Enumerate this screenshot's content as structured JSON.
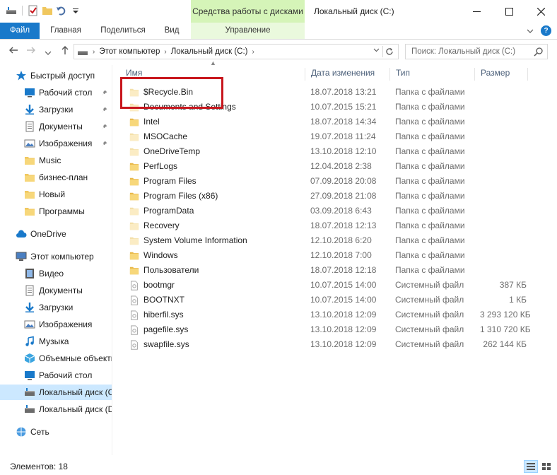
{
  "window": {
    "title": "Локальный диск (C:)",
    "context_tab_title": "Средства работы с дисками"
  },
  "ribbon": {
    "tabs": [
      "Файл",
      "Главная",
      "Поделиться",
      "Вид",
      "Управление"
    ]
  },
  "address": {
    "crumbs": [
      "Этот компьютер",
      "Локальный диск (C:)"
    ],
    "search_placeholder": "Поиск: Локальный диск (C:)"
  },
  "nav": {
    "items": [
      {
        "label": "Быстрый доступ",
        "icon": "star-icon"
      },
      {
        "label": "Рабочий стол",
        "icon": "desktop-icon"
      },
      {
        "label": "Загрузки",
        "icon": "downloads-icon"
      },
      {
        "label": "Документы",
        "icon": "documents-icon"
      },
      {
        "label": "Изображения",
        "icon": "pictures-icon"
      },
      {
        "label": "Music",
        "icon": "folder-icon"
      },
      {
        "label": "бизнес-план",
        "icon": "folder-icon"
      },
      {
        "label": "Новый",
        "icon": "folder-icon"
      },
      {
        "label": "Программы",
        "icon": "folder-icon"
      },
      {
        "label": "OneDrive",
        "icon": "cloud-icon"
      },
      {
        "label": "Этот компьютер",
        "icon": "computer-icon"
      },
      {
        "label": "Видео",
        "icon": "video-icon"
      },
      {
        "label": "Документы",
        "icon": "documents-icon"
      },
      {
        "label": "Загрузки",
        "icon": "downloads-icon"
      },
      {
        "label": "Изображения",
        "icon": "pictures-icon"
      },
      {
        "label": "Музыка",
        "icon": "music-icon"
      },
      {
        "label": "Объемные объекты",
        "icon": "3d-objects-icon"
      },
      {
        "label": "Рабочий стол",
        "icon": "desktop-icon"
      },
      {
        "label": "Локальный диск (C:)",
        "icon": "drive-icon"
      },
      {
        "label": "Локальный диск (D:)",
        "icon": "drive-icon"
      },
      {
        "label": "Сеть",
        "icon": "network-icon"
      }
    ]
  },
  "columns": {
    "name": "Имя",
    "date": "Дата изменения",
    "type": "Тип",
    "size": "Размер"
  },
  "files": [
    {
      "name": "$Recycle.Bin",
      "date": "18.07.2018 13:21",
      "type": "Папка с файлами",
      "size": "",
      "kind": "folder-faded"
    },
    {
      "name": "Documents and Settings",
      "date": "10.07.2015 15:21",
      "type": "Папка с файлами",
      "size": "",
      "kind": "folder-faded"
    },
    {
      "name": "Intel",
      "date": "18.07.2018 14:34",
      "type": "Папка с файлами",
      "size": "",
      "kind": "folder"
    },
    {
      "name": "MSOCache",
      "date": "19.07.2018 11:24",
      "type": "Папка с файлами",
      "size": "",
      "kind": "folder-faded"
    },
    {
      "name": "OneDriveTemp",
      "date": "13.10.2018 12:10",
      "type": "Папка с файлами",
      "size": "",
      "kind": "folder-faded"
    },
    {
      "name": "PerfLogs",
      "date": "12.04.2018 2:38",
      "type": "Папка с файлами",
      "size": "",
      "kind": "folder"
    },
    {
      "name": "Program Files",
      "date": "07.09.2018 20:08",
      "type": "Папка с файлами",
      "size": "",
      "kind": "folder"
    },
    {
      "name": "Program Files (x86)",
      "date": "27.09.2018 21:08",
      "type": "Папка с файлами",
      "size": "",
      "kind": "folder"
    },
    {
      "name": "ProgramData",
      "date": "03.09.2018 6:43",
      "type": "Папка с файлами",
      "size": "",
      "kind": "folder-faded"
    },
    {
      "name": "Recovery",
      "date": "18.07.2018 12:13",
      "type": "Папка с файлами",
      "size": "",
      "kind": "folder-faded"
    },
    {
      "name": "System Volume Information",
      "date": "12.10.2018 6:20",
      "type": "Папка с файлами",
      "size": "",
      "kind": "folder-faded"
    },
    {
      "name": "Windows",
      "date": "12.10.2018 7:00",
      "type": "Папка с файлами",
      "size": "",
      "kind": "folder"
    },
    {
      "name": "Пользователи",
      "date": "18.07.2018 12:18",
      "type": "Папка с файлами",
      "size": "",
      "kind": "folder"
    },
    {
      "name": "bootmgr",
      "date": "10.07.2015 14:00",
      "type": "Системный файл",
      "size": "387 КБ",
      "kind": "system-file"
    },
    {
      "name": "BOOTNXT",
      "date": "10.07.2015 14:00",
      "type": "Системный файл",
      "size": "1 КБ",
      "kind": "system-file"
    },
    {
      "name": "hiberfil.sys",
      "date": "13.10.2018 12:09",
      "type": "Системный файл",
      "size": "3 293 120 КБ",
      "kind": "system-file"
    },
    {
      "name": "pagefile.sys",
      "date": "13.10.2018 12:09",
      "type": "Системный файл",
      "size": "1 310 720 КБ",
      "kind": "system-file"
    },
    {
      "name": "swapfile.sys",
      "date": "13.10.2018 12:09",
      "type": "Системный файл",
      "size": "262 144 КБ",
      "kind": "system-file"
    }
  ],
  "status": {
    "text": "Элементов: 18"
  },
  "colors": {
    "accent": "#1979ca",
    "selection": "#cce8ff",
    "context_tab": "#d5f4b8",
    "highlight_box": "#c8161d",
    "folder": "#f0c75e"
  }
}
